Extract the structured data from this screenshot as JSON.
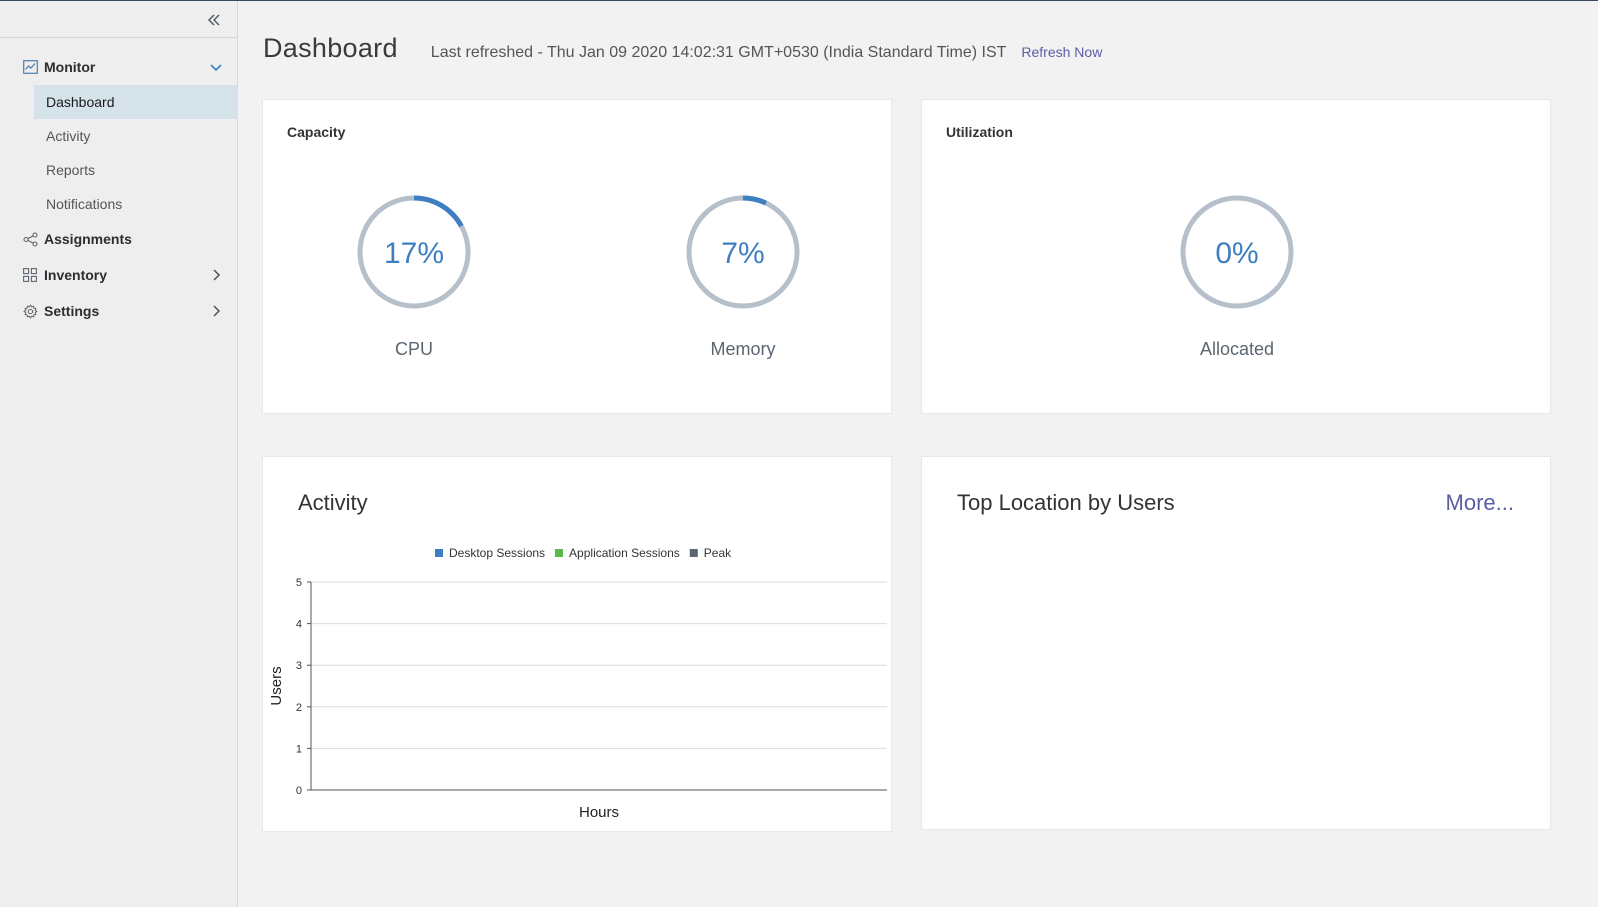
{
  "sidebar": {
    "groups": {
      "monitor": {
        "label": "Monitor",
        "icon": "monitor-chart-icon",
        "expanded": true,
        "items": [
          {
            "label": "Dashboard",
            "active": true
          },
          {
            "label": "Activity"
          },
          {
            "label": "Reports"
          },
          {
            "label": "Notifications"
          }
        ]
      },
      "assignments": {
        "label": "Assignments",
        "icon": "share-nodes-icon"
      },
      "inventory": {
        "label": "Inventory",
        "icon": "grid-icon"
      },
      "settings": {
        "label": "Settings",
        "icon": "gear-icon"
      }
    }
  },
  "header": {
    "title": "Dashboard",
    "last_refreshed": "Last refreshed - Thu Jan 09 2020 14:02:31 GMT+0530 (India Standard Time) IST",
    "refresh_label": "Refresh Now"
  },
  "capacity": {
    "title": "Capacity",
    "cpu": {
      "value_text": "17%",
      "percent": 17,
      "label": "CPU"
    },
    "memory": {
      "value_text": "7%",
      "percent": 7,
      "label": "Memory"
    }
  },
  "utilization": {
    "title": "Utilization",
    "allocated": {
      "value_text": "0%",
      "percent": 0,
      "label": "Allocated"
    }
  },
  "activity": {
    "title": "Activity"
  },
  "top_location": {
    "title": "Top Location by Users",
    "more_label": "More..."
  },
  "colors": {
    "accent": "#3d7fc1",
    "gauge_track": "#b5c0ca",
    "link": "#5b5ea6",
    "desktop_sessions": "#3d7fc1",
    "application_sessions": "#5ab946",
    "peak": "#5c6670"
  },
  "chart_data": {
    "type": "line",
    "title": "",
    "xlabel": "Hours",
    "ylabel": "Users",
    "ylim": [
      0,
      5
    ],
    "yticks": [
      "0",
      "1",
      "2",
      "3",
      "4",
      "5"
    ],
    "x": [],
    "series": [
      {
        "name": "Desktop Sessions",
        "values": []
      },
      {
        "name": "Application Sessions",
        "values": []
      },
      {
        "name": "Peak",
        "values": []
      }
    ],
    "legend": "top-center",
    "grid": true
  }
}
